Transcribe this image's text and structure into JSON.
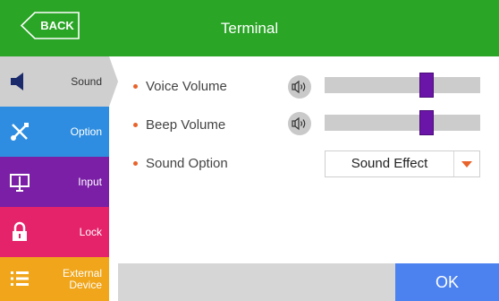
{
  "header": {
    "back_label": "BACK",
    "title": "Terminal",
    "color": "#2aa526"
  },
  "sidebar": {
    "items": [
      {
        "label": "Sound",
        "icon": "speaker-icon",
        "color": "#cfcfcf",
        "active": true
      },
      {
        "label": "Option",
        "icon": "tools-icon",
        "color": "#2e8de0"
      },
      {
        "label": "Input",
        "icon": "monitor-icon",
        "color": "#7a1fa6"
      },
      {
        "label": "Lock",
        "icon": "lock-icon",
        "color": "#e5236a"
      },
      {
        "label": "External Device",
        "icon": "list-icon",
        "color": "#f0a51a"
      }
    ]
  },
  "settings": {
    "voice_volume": {
      "label": "Voice Volume",
      "icon": "volume-icon",
      "level": 0.67
    },
    "beep_volume": {
      "label": "Beep Volume",
      "icon": "volume-icon",
      "level": 0.67
    },
    "sound_option": {
      "label": "Sound Option",
      "value": "Sound Effect"
    }
  },
  "footer": {
    "ok_label": "OK",
    "ok_color": "#4c82f0"
  }
}
